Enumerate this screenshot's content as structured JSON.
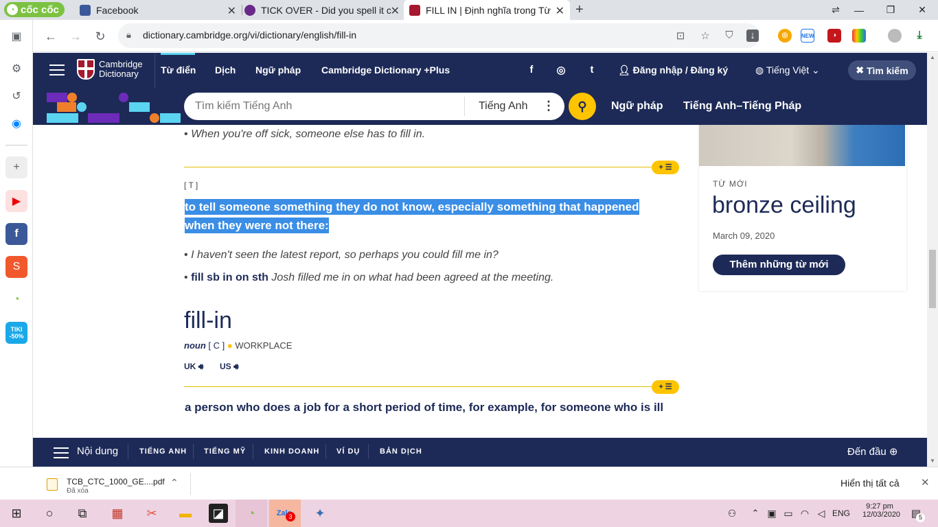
{
  "browser": {
    "brand": "cốc cốc",
    "tabs": [
      {
        "title": "Facebook",
        "close": "✕"
      },
      {
        "title": "TICK OVER - Did you spell it c",
        "close": "✕"
      },
      {
        "title": "FILL IN | Định nghĩa trong Từ",
        "close": "✕"
      }
    ],
    "new_tab": "+",
    "url": "dictionary.cambridge.org/vi/dictionary/english/fill-in",
    "ext_new_badge": "NEW",
    "tiki_badge": "TIKI -50%"
  },
  "site": {
    "logo_line1": "Cambridge",
    "logo_line2": "Dictionary",
    "nav": [
      "Từ điển",
      "Dịch",
      "Ngữ pháp",
      "Cambridge Dictionary +Plus"
    ],
    "social": [
      "f",
      "◎",
      "t"
    ],
    "login": "Đăng nhập / Đăng ký",
    "language": "Tiếng Việt",
    "search_btn": "Tìm kiếm",
    "search_placeholder": "Tìm kiếm Tiếng Anh",
    "search_lang": "Tiếng Anh",
    "subnav": [
      "Ngữ pháp",
      "Tiếng Anh–Tiếng Pháp"
    ]
  },
  "entry": {
    "example_top": "When you're off sick, someone else has to fill in.",
    "grammar": "[ T ]",
    "definition": "to tell someone something they do not know, especially something that happened when they were not there:",
    "example_1": "I haven't seen the latest report, so perhaps you could fill me in?",
    "phrase": "fill sb in on sth",
    "phrase_example": "Josh filled me in on what had been agreed at the meeting.",
    "headword2": "fill-in",
    "pos2": "noun",
    "gram2": "[ C ]",
    "domain2": "WORKPLACE",
    "uk": "UK",
    "us": "US",
    "definition2": "a person who does a job for a short period of time, for example, for someone who is ill",
    "bullet": "•"
  },
  "card": {
    "label": "TỪ MỚI",
    "word": "bronze ceiling",
    "date": "March 09, 2020",
    "button": "Thêm những từ mới"
  },
  "bottom_nav": {
    "contents": "Nội dung",
    "items": [
      "TIẾNG ANH",
      "TIẾNG MỸ",
      "KINH DOANH",
      "VÍ DỤ",
      "BẢN DỊCH"
    ],
    "to_top": "Đến đầu"
  },
  "downloads": {
    "file": "TCB_CTC_1000_GE....pdf",
    "status": "Đã xóa",
    "show_all": "Hiển thị tất cả"
  },
  "taskbar": {
    "lang": "ENG",
    "time": "9:27 pm",
    "date": "12/03/2020",
    "zalo_badge": "3",
    "notif": "5"
  },
  "colors": {
    "navy": "#1d2a57",
    "yellow": "#fec400",
    "selection": "#3a8ee6"
  }
}
